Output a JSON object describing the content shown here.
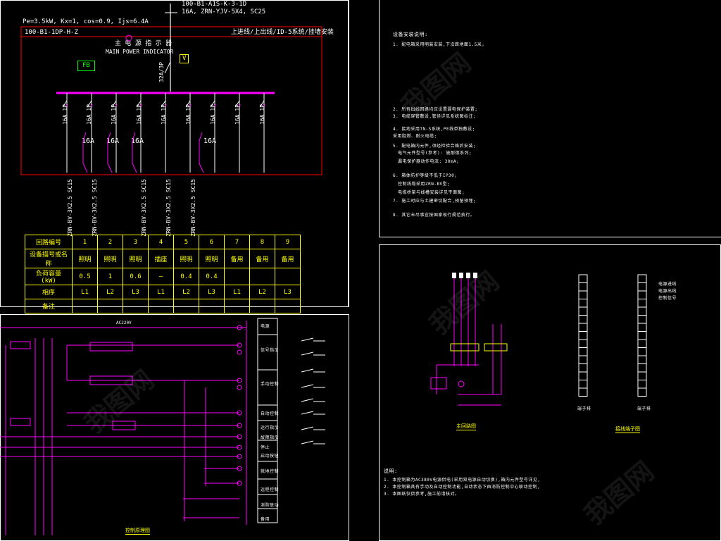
{
  "header": {
    "top_line1": "100-B1-A1S-K-3-1D",
    "top_line2": "16A, ZRN-YJV-5X4, SC25",
    "spec": "Pe=3.5kW, Kx=1, cos=0.9, Ijs=6.4A",
    "panel_id": "100-B1-1DP-H-Z",
    "install_note": "上进线/上出线/ID-5系统/挂墙安装",
    "fb_label": "FB",
    "v_label": "V",
    "main_switch_cn": "主 电 源 指 示 器",
    "main_switch_en": "MAIN POWER INDICATOR",
    "main_breaker": "32A/3P"
  },
  "breakers": [
    {
      "label": "16A 1P"
    },
    {
      "label": "16A 1P"
    },
    {
      "label": "16A 1P"
    },
    {
      "label": "16A 1P"
    },
    {
      "label": "16A 1P"
    },
    {
      "label": "16A 1P"
    },
    {
      "label": "16A 1P"
    },
    {
      "label": "16A 1P"
    },
    {
      "label": "16A 1P"
    }
  ],
  "rcd_labels": [
    "16A",
    "16A",
    "16A",
    "16A"
  ],
  "cables": [
    "ZRN-BV-3X2.5 SC15",
    "ZRN-BV-3X2.5 SC15",
    "ZRN-BV-3X2.5 SC15",
    "ZRN-BV-3X2.5 SC15",
    "ZRN-BV-3X2.5 SC15"
  ],
  "load_table": {
    "rows": [
      {
        "head": "回路编号",
        "cells": [
          "1",
          "2",
          "3",
          "4",
          "5",
          "6",
          "7",
          "8",
          "9"
        ]
      },
      {
        "head": "设备描号或名称",
        "cells": [
          "照明",
          "照明",
          "照明",
          "插座",
          "照明",
          "照明",
          "备用",
          "备用",
          "备用"
        ]
      },
      {
        "head": "负荷容量 (kW)",
        "cells": [
          "0.5",
          "1",
          "0.6",
          "—",
          "0.4",
          "0.4",
          "",
          "",
          ""
        ]
      },
      {
        "head": "相序",
        "cells": [
          "L1",
          "L2",
          "L3",
          "L1",
          "L2",
          "L3",
          "L1",
          "L2",
          "L3"
        ]
      },
      {
        "head": "备注",
        "cells": [
          "",
          "",
          "",
          "",
          "",
          "",
          "",
          "",
          ""
        ]
      }
    ]
  },
  "notes": {
    "title": "设备安装说明:",
    "lines": [
      "1. 配电箱采用明装安装,下沿距地面1.5米;",
      "2. 所有出线回路均应设置漏电保护装置;",
      "3. 电缆穿管敷设,管径详见系统图标注;",
      "4. 接地采用TN-S系统,PE线单独敷设;",
      "   采用阻燃、耐火电缆;",
      "5. 配电箱内元件,须经检验合格后安装;",
      "   电气元件型号(参考): 施耐德系列;",
      "   漏电保护器动作电流: 30mA;",
      "6. 箱体防护等级不低于IP30;",
      "   控制线缆采用ZRN-BV型;",
      "   电缆桥架与线槽安装详见平面图;",
      "7. 施工时应与土建密切配合,预留预埋;",
      "8. 其它未尽事宜按国家现行规范执行。"
    ]
  },
  "control": {
    "top_label": "AC220V",
    "right_labels": [
      "电源",
      "信号指示",
      "手动控制",
      "自动控制",
      "运行指示",
      "故障指示",
      "停止",
      "启动按钮",
      "就地控制",
      "远程控制",
      "消防联动",
      "备用"
    ],
    "caption": "控制原理图"
  },
  "motor_panel": {
    "caption1": "主回路图",
    "caption2": "接线端子图",
    "terminal_label1": "端子排",
    "terminal_label2": "端子排",
    "notes_title": "说明:",
    "notes": [
      "1. 本控制箱为AC380V电源供电(采用双电源自动切换),箱内元件型号详见,",
      "2. 本控制箱具有手动及自动控制功能,自动状态下由消防控制中心联动控制,",
      "3. 本图纸仅供参考,施工前请核对。"
    ],
    "terminal_right": [
      "电源进线",
      "电源出线",
      "控制信号"
    ]
  },
  "watermark": "我图网",
  "colors": {
    "accent": "#ff00ff",
    "frame": "#ffffff",
    "text": "#ffff00",
    "fb": "#00ff00"
  }
}
